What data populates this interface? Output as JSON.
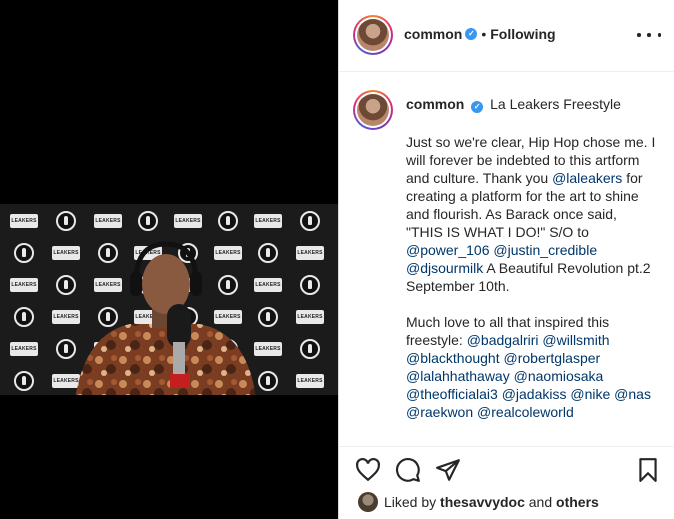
{
  "post": {
    "username": "common",
    "follow_status": "Following",
    "separator": "•",
    "location_title": "La Leakers Freestyle",
    "verified_mark": "✓",
    "video_backdrop_text": "LEAKERS",
    "caption": {
      "p1_a": "Just so we're clear, Hip Hop chose me. I will forever be indebted to this artform and culture. Thank you ",
      "m_laleakers": "@laleakers",
      "p1_b": " for creating a platform for the art to shine and flourish. As Barack once said, \"THIS IS WHAT I DO!\" S/O to ",
      "m_power": "@power_106",
      "m_justin": "@justin_credible",
      "m_dj": "@djsourmilk",
      "p1_c": " A Beautiful Revolution pt.2 September 10th.",
      "p2_a": "Much love to all that inspired this freestyle: ",
      "m_badgal": "@badgalriri",
      "m_willsmith": "@willsmith",
      "m_blackthought": "@blackthought",
      "m_glasper": "@robertglasper",
      "m_lalah": "@lalahhathaway",
      "m_naomi": "@naomiosaka",
      "m_ali": "@theofficialai3",
      "m_jadakiss": "@jadakiss",
      "m_nike": "@nike",
      "m_nas": "@nas",
      "m_raekwon": "@raekwon",
      "m_cole": "@realcoleworld"
    },
    "likes": {
      "prefix": "Liked by ",
      "user": "thesavvydoc",
      "middle": " and ",
      "others": "others"
    }
  },
  "icons": {
    "like": "heart-icon",
    "comment": "comment-icon",
    "share": "share-icon",
    "save": "bookmark-icon",
    "more": "more-options-icon"
  },
  "colors": {
    "mention": "#00376b",
    "verified": "#3897f0",
    "text": "#262626"
  }
}
